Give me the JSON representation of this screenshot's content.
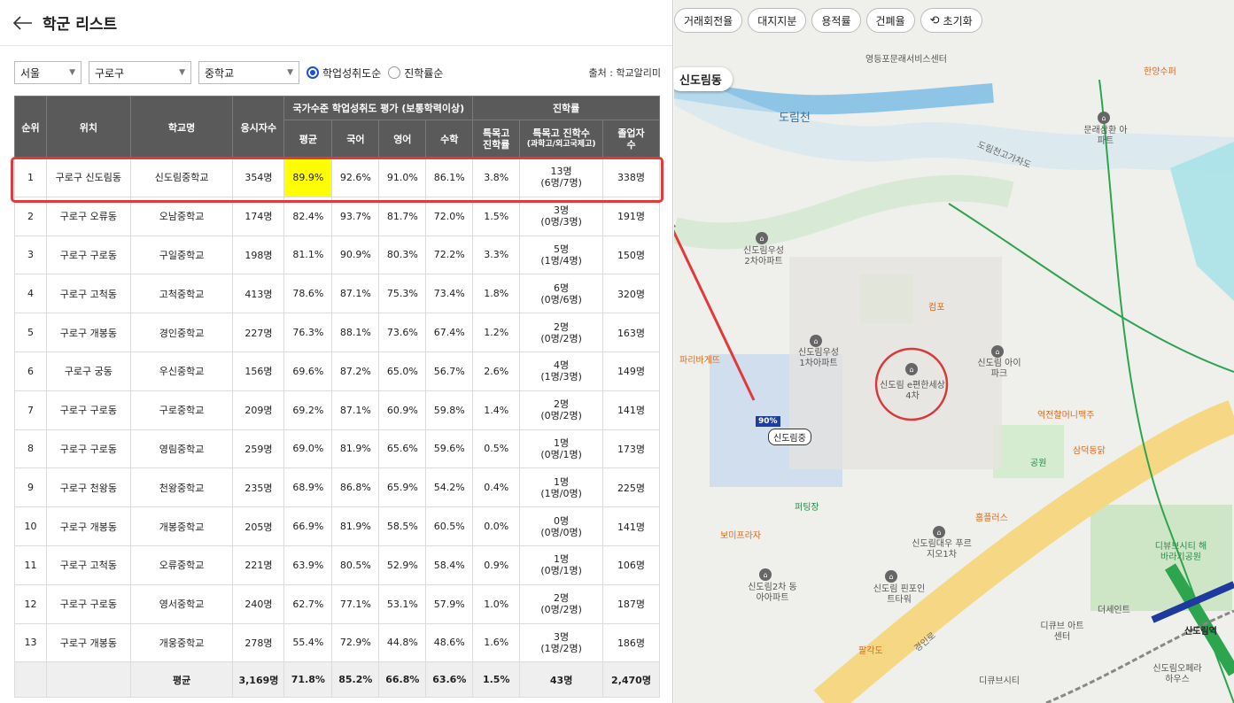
{
  "header": {
    "title": "학군 리스트"
  },
  "filters": {
    "city": "서울",
    "district": "구로구",
    "school_level": "중학교",
    "radio_achievement": "학업성취도순",
    "radio_advance": "진학률순",
    "source": "출처 : 학교알리미"
  },
  "table": {
    "headers": {
      "rank": "순위",
      "location": "위치",
      "school": "학교명",
      "examinees": "응시자수",
      "national_group": "국가수준 학업성취도 평가 (보통학력이상)",
      "avg": "평균",
      "korean": "국어",
      "english": "영어",
      "math": "수학",
      "advance_group": "진학률",
      "special_rate_1": "특목고",
      "special_rate_2": "진학률",
      "special_count_1": "특목고 진학수",
      "special_count_2": "(과학고/외고국제고)",
      "graduates_1": "졸업자",
      "graduates_2": "수"
    },
    "rows": [
      {
        "rank": "1",
        "location": "구로구 신도림동",
        "school": "신도림중학교",
        "examinees": "354명",
        "avg": "89.9%",
        "korean": "92.6%",
        "english": "91.0%",
        "math": "86.1%",
        "special_rate": "3.8%",
        "count_main": "13명",
        "count_sub": "(6명/7명)",
        "graduates": "338명"
      },
      {
        "rank": "2",
        "location": "구로구 오류동",
        "school": "오남중학교",
        "examinees": "174명",
        "avg": "82.4%",
        "korean": "93.7%",
        "english": "81.7%",
        "math": "72.0%",
        "special_rate": "1.5%",
        "count_main": "3명",
        "count_sub": "(0명/3명)",
        "graduates": "191명"
      },
      {
        "rank": "3",
        "location": "구로구 구로동",
        "school": "구일중학교",
        "examinees": "198명",
        "avg": "81.1%",
        "korean": "90.9%",
        "english": "80.3%",
        "math": "72.2%",
        "special_rate": "3.3%",
        "count_main": "5명",
        "count_sub": "(1명/4명)",
        "graduates": "150명"
      },
      {
        "rank": "4",
        "location": "구로구 고척동",
        "school": "고척중학교",
        "examinees": "413명",
        "avg": "78.6%",
        "korean": "87.1%",
        "english": "75.3%",
        "math": "73.4%",
        "special_rate": "1.8%",
        "count_main": "6명",
        "count_sub": "(0명/6명)",
        "graduates": "320명"
      },
      {
        "rank": "5",
        "location": "구로구 개봉동",
        "school": "경인중학교",
        "examinees": "227명",
        "avg": "76.3%",
        "korean": "88.1%",
        "english": "73.6%",
        "math": "67.4%",
        "special_rate": "1.2%",
        "count_main": "2명",
        "count_sub": "(0명/2명)",
        "graduates": "163명"
      },
      {
        "rank": "6",
        "location": "구로구 궁동",
        "school": "우신중학교",
        "examinees": "156명",
        "avg": "69.6%",
        "korean": "87.2%",
        "english": "65.0%",
        "math": "56.7%",
        "special_rate": "2.6%",
        "count_main": "4명",
        "count_sub": "(1명/3명)",
        "graduates": "149명"
      },
      {
        "rank": "7",
        "location": "구로구 구로동",
        "school": "구로중학교",
        "examinees": "209명",
        "avg": "69.2%",
        "korean": "87.1%",
        "english": "60.9%",
        "math": "59.8%",
        "special_rate": "1.4%",
        "count_main": "2명",
        "count_sub": "(0명/2명)",
        "graduates": "141명"
      },
      {
        "rank": "8",
        "location": "구로구 구로동",
        "school": "영림중학교",
        "examinees": "259명",
        "avg": "69.0%",
        "korean": "81.9%",
        "english": "65.6%",
        "math": "59.6%",
        "special_rate": "0.5%",
        "count_main": "1명",
        "count_sub": "(0명/1명)",
        "graduates": "173명"
      },
      {
        "rank": "9",
        "location": "구로구 천왕동",
        "school": "천왕중학교",
        "examinees": "235명",
        "avg": "68.9%",
        "korean": "86.8%",
        "english": "65.9%",
        "math": "54.2%",
        "special_rate": "0.4%",
        "count_main": "1명",
        "count_sub": "(1명/0명)",
        "graduates": "225명"
      },
      {
        "rank": "10",
        "location": "구로구 개봉동",
        "school": "개봉중학교",
        "examinees": "205명",
        "avg": "66.9%",
        "korean": "81.9%",
        "english": "58.5%",
        "math": "60.5%",
        "special_rate": "0.0%",
        "count_main": "0명",
        "count_sub": "(0명/0명)",
        "graduates": "141명"
      },
      {
        "rank": "11",
        "location": "구로구 고척동",
        "school": "오류중학교",
        "examinees": "221명",
        "avg": "63.9%",
        "korean": "80.5%",
        "english": "52.9%",
        "math": "58.4%",
        "special_rate": "0.9%",
        "count_main": "1명",
        "count_sub": "(0명/1명)",
        "graduates": "106명"
      },
      {
        "rank": "12",
        "location": "구로구 구로동",
        "school": "영서중학교",
        "examinees": "240명",
        "avg": "62.7%",
        "korean": "77.1%",
        "english": "53.1%",
        "math": "57.9%",
        "special_rate": "1.0%",
        "count_main": "2명",
        "count_sub": "(0명/2명)",
        "graduates": "187명"
      },
      {
        "rank": "13",
        "location": "구로구 개봉동",
        "school": "개웅중학교",
        "examinees": "278명",
        "avg": "55.4%",
        "korean": "72.9%",
        "english": "44.8%",
        "math": "48.6%",
        "special_rate": "1.6%",
        "count_main": "3명",
        "count_sub": "(1명/2명)",
        "graduates": "186명"
      }
    ],
    "footer": {
      "label": "평균",
      "examinees": "3,169명",
      "avg": "71.8%",
      "korean": "85.2%",
      "english": "66.8%",
      "math": "63.6%",
      "special_rate": "1.5%",
      "count": "43명",
      "graduates": "2,470명"
    }
  },
  "map": {
    "toolbar": [
      "거래회전율",
      "대지지분",
      "용적률",
      "건폐율"
    ],
    "reset_label": "초기화",
    "area_chip": "신도림동",
    "school_tag": "신도림중",
    "school_pct": "90%",
    "labels": {
      "stream": "도림천",
      "road1": "도림천고가차도",
      "road2": "경인로",
      "station": "신도림역",
      "apt1": "신도림 e편한세상4차",
      "apt2": "신도림우성 1차아파트",
      "apt3": "신도림우성 2차아파트",
      "apt4": "신도림 아이파크",
      "apt5": "신도림대우 푸르지오1차",
      "apt6": "신도림 핀포인트타워",
      "apt7": "신도림2차 동아아파트",
      "apt8": "문래삼환 아파트",
      "poi1": "파리바게뜨",
      "poi2": "보미프라자",
      "poi3": "컴포",
      "poi4": "홈플러스",
      "poi5": "한양수퍼",
      "poi6": "역전할머니맥주",
      "poi7": "삼덕동닭",
      "poi8": "디큐브 아트센터",
      "poi9": "더세인트",
      "poi10": "퍼팅장",
      "poi11": "공원",
      "poi12": "영등포문래서비스센터",
      "poi13": "신도림오페라 하우스",
      "poi14": "디큐브시티",
      "poi15": "팔각도",
      "poi16": "디뷰브시티 해바라기공원"
    }
  }
}
